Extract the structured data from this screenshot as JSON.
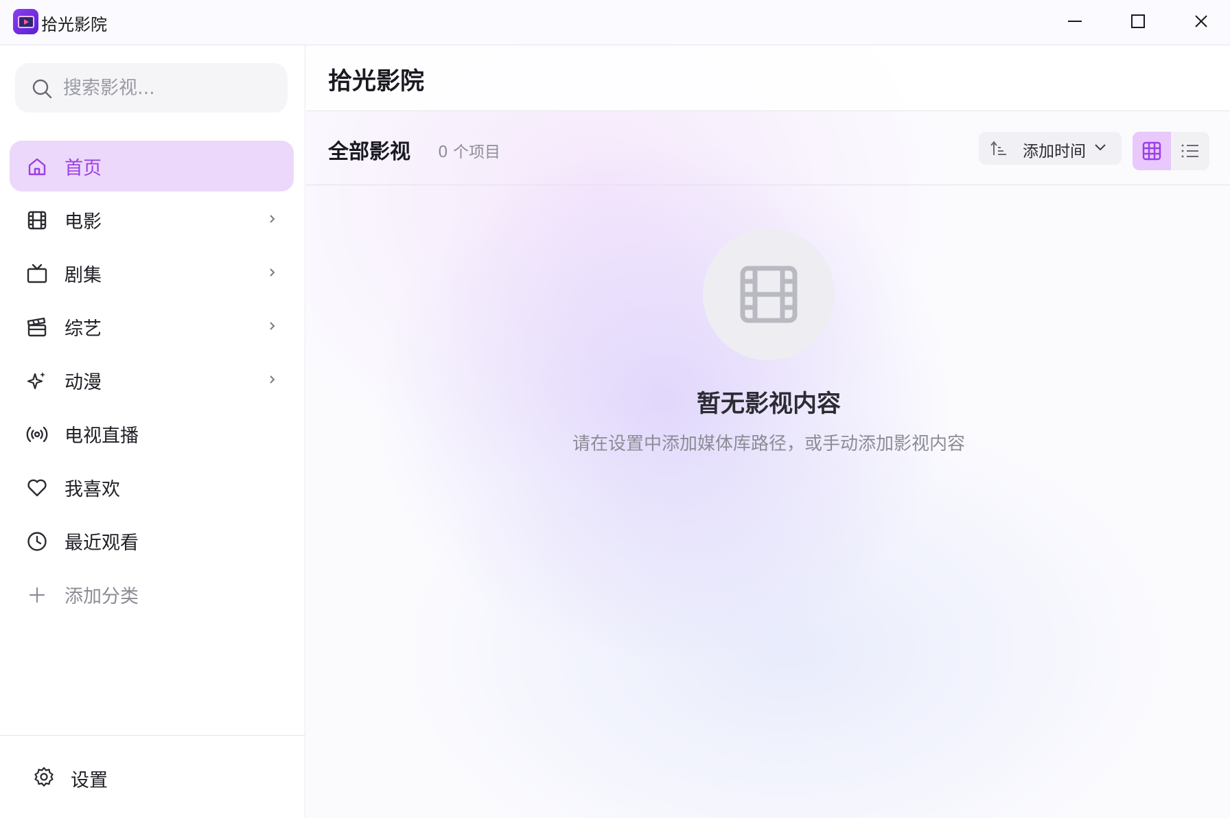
{
  "app": {
    "title": "拾光影院"
  },
  "window_controls": {
    "minimize": "minimize",
    "maximize": "maximize",
    "close": "close"
  },
  "sidebar": {
    "search_placeholder": "搜索影视...",
    "items": [
      {
        "label": "首页",
        "icon": "home-icon",
        "active": true,
        "has_chevron": false
      },
      {
        "label": "电影",
        "icon": "film-icon",
        "has_chevron": true
      },
      {
        "label": "剧集",
        "icon": "tv-icon",
        "has_chevron": true
      },
      {
        "label": "综艺",
        "icon": "clapperboard-icon",
        "has_chevron": true
      },
      {
        "label": "动漫",
        "icon": "sparkle-icon",
        "has_chevron": true
      },
      {
        "label": "电视直播",
        "icon": "broadcast-icon",
        "has_chevron": false
      },
      {
        "label": "我喜欢",
        "icon": "heart-icon",
        "has_chevron": false
      },
      {
        "label": "最近观看",
        "icon": "clock-icon",
        "has_chevron": false
      },
      {
        "label": "添加分类",
        "icon": "plus-icon",
        "has_chevron": false
      }
    ],
    "settings_label": "设置"
  },
  "main": {
    "title": "拾光影院",
    "section_title": "全部影视",
    "item_count": "0 个项目",
    "sort_label": "添加时间",
    "view_mode": "grid",
    "empty": {
      "title": "暂无影视内容",
      "description": "请在设置中添加媒体库路径，或手动添加影视内容"
    }
  },
  "colors": {
    "accent": "#9a3fe6",
    "active_bg": "#ecd8fb",
    "view_active_bg": "#e9c8fb",
    "muted_text": "#8c8c96"
  }
}
